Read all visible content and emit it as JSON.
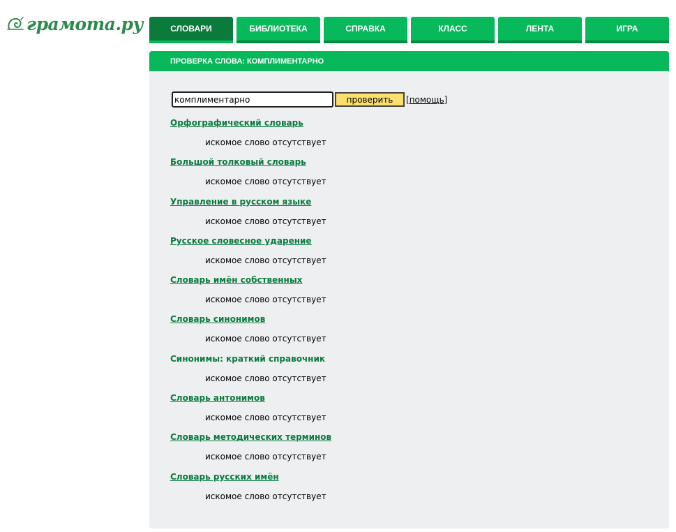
{
  "colors": {
    "brand_green": "#07b95a",
    "active_tab": "#0b7a3d",
    "link_green": "#0a7a3f",
    "button_yellow": "#fbe06e",
    "panel_bg": "#edeff0"
  },
  "logo": {
    "icon": "snail-spiral-icon",
    "text": "грамота.ру"
  },
  "nav": {
    "tabs": [
      {
        "label": "СЛОВАРИ",
        "active": true
      },
      {
        "label": "БИБЛИОТЕКА",
        "active": false
      },
      {
        "label": "СПРАВКА",
        "active": false
      },
      {
        "label": "КЛАСС",
        "active": false
      },
      {
        "label": "ЛЕНТА",
        "active": false
      },
      {
        "label": "ИГРА",
        "active": false
      }
    ]
  },
  "panel": {
    "header": "ПРОВЕРКА СЛОВА: КОМПЛИМЕНТАРНО"
  },
  "search": {
    "value": "комплиментарно",
    "button_label": "проверить",
    "help_open": "[",
    "help_label": "помощь",
    "help_close": "]"
  },
  "dictionaries": [
    {
      "title": "Орфографический словарь",
      "result": "искомое слово отсутствует",
      "link": true
    },
    {
      "title": "Большой толковый словарь",
      "result": "искомое слово отсутствует",
      "link": true
    },
    {
      "title": "Управление в русском языке",
      "result": "искомое слово отсутствует",
      "link": true
    },
    {
      "title": "Русское словесное ударение",
      "result": "искомое слово отсутствует",
      "link": true
    },
    {
      "title": "Словарь имён собственных",
      "result": "искомое слово отсутствует",
      "link": true
    },
    {
      "title": "Словарь синонимов",
      "result": "искомое слово отсутствует",
      "link": true
    },
    {
      "title": "Синонимы: краткий справочник",
      "result": "искомое слово отсутствует",
      "link": false
    },
    {
      "title": "Словарь антонимов",
      "result": "искомое слово отсутствует",
      "link": true
    },
    {
      "title": "Словарь методических терминов",
      "result": "искомое слово отсутствует",
      "link": true
    },
    {
      "title": "Словарь русских имён",
      "result": "искомое слово отсутствует",
      "link": true
    }
  ]
}
